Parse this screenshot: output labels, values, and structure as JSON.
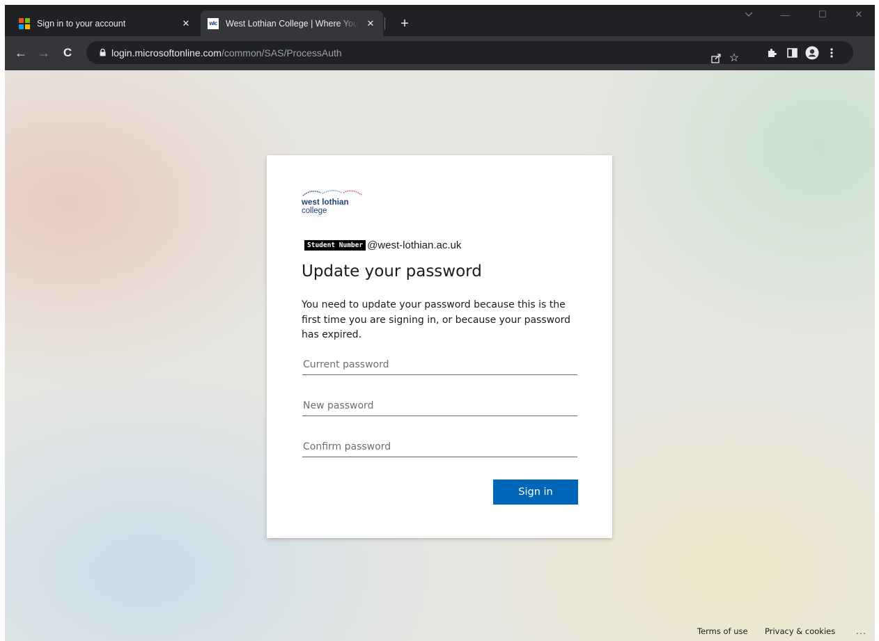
{
  "browser": {
    "tabs": [
      {
        "title": "Sign in to your account",
        "close": "✕",
        "favicon": "microsoft-logo-icon"
      },
      {
        "title": "West Lothian College | Where You",
        "close": "✕",
        "favicon_text": "wlc"
      }
    ],
    "new_tab": "+",
    "window_controls": {
      "minimize": "—",
      "maximize": "☐",
      "close": "✕"
    },
    "nav": {
      "back": "←",
      "forward": "→",
      "reload": "C"
    },
    "url": {
      "host": "login.microsoftonline.com",
      "path": "/common/SAS/ProcessAuth"
    },
    "toolbar_icons": [
      "share-icon",
      "bookmark-star-icon",
      "extensions-icon",
      "side-panel-icon",
      "profile-icon",
      "menu-icon"
    ]
  },
  "signin_card": {
    "brand": {
      "line1": "west lothian",
      "line2": "college"
    },
    "identity": {
      "redacted_label": "Student Number",
      "domain": "@west-lothian.ac.uk"
    },
    "heading": "Update your password",
    "description": "You need to update your password because this is the first time you are signing in, or because your password has expired.",
    "fields": {
      "current_password": {
        "placeholder": "Current password",
        "value": ""
      },
      "new_password": {
        "placeholder": "New password",
        "value": ""
      },
      "confirm_password": {
        "placeholder": "Confirm password",
        "value": ""
      }
    },
    "submit_label": "Sign in"
  },
  "footer": {
    "terms": "Terms of use",
    "privacy": "Privacy & cookies",
    "more": "..."
  },
  "colors": {
    "accent": "#0067b8",
    "brand_navy": "#1f3e7a",
    "chrome_dark": "#202124",
    "chrome_toolbar": "#35363a"
  }
}
